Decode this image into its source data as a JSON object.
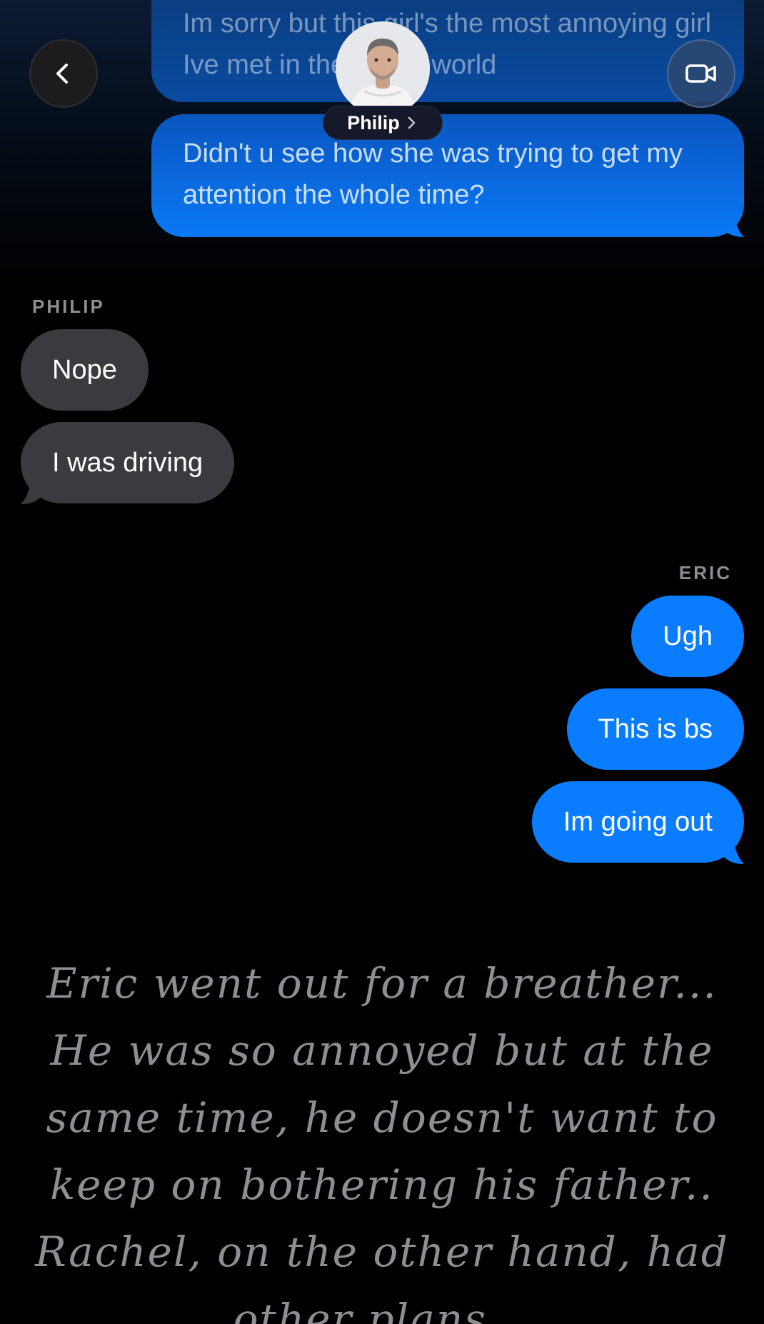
{
  "header": {
    "contact_name": "Philip"
  },
  "messages_top": {
    "faded_text": "Im sorry but this girl's the most annoying girl Ive met in the whole world",
    "text": "Didn't u see how she was trying to get my attention the whole time?"
  },
  "group_philip": {
    "sender": "PHILIP",
    "messages": [
      "Nope",
      "I was driving"
    ]
  },
  "group_eric": {
    "sender": "ERIC",
    "messages": [
      "Ugh",
      "This is bs",
      "Im going out"
    ]
  },
  "narration": "Eric went out for a breather... He was so annoyed but at the same time, he doesn't want to keep on bothering his father.. Rachel, on the other hand, had other plans...",
  "colors": {
    "outgoing_bubble": "#0a7cff",
    "incoming_bubble": "#3b3b3f",
    "background": "#000000",
    "label_gray": "#8e8e93"
  },
  "icons": {
    "back": "chevron-left-icon",
    "video": "video-camera-icon",
    "name_chevron": "chevron-right-icon"
  }
}
